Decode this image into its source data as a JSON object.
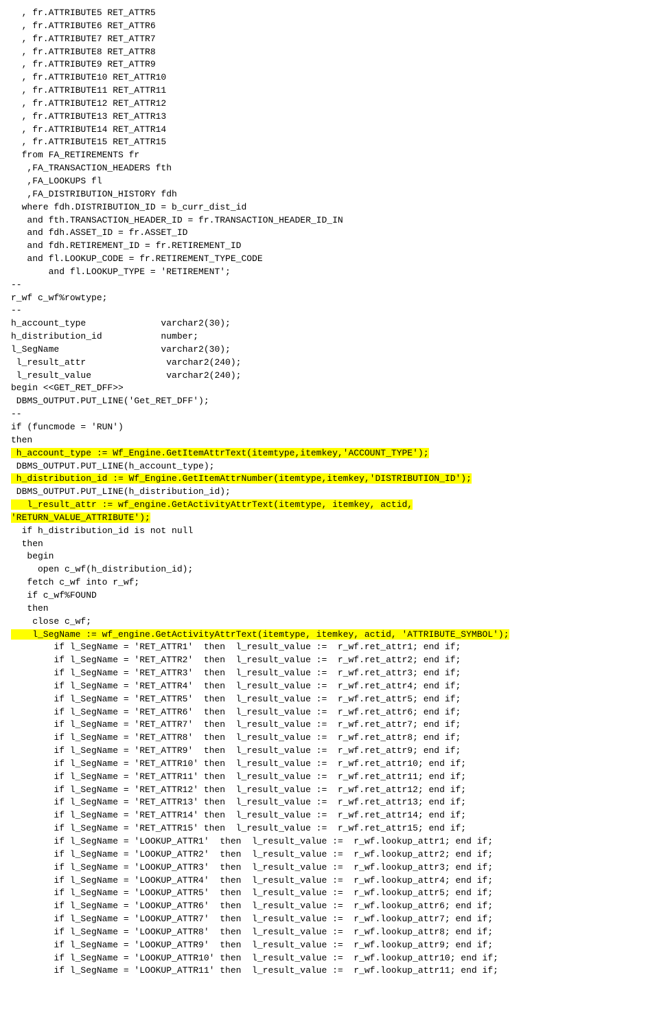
{
  "code": {
    "lines": [
      {
        "text": "  , fr.ATTRIBUTE5 RET_ATTR5",
        "highlight": false
      },
      {
        "text": "  , fr.ATTRIBUTE6 RET_ATTR6",
        "highlight": false
      },
      {
        "text": "  , fr.ATTRIBUTE7 RET_ATTR7",
        "highlight": false
      },
      {
        "text": "  , fr.ATTRIBUTE8 RET_ATTR8",
        "highlight": false
      },
      {
        "text": "  , fr.ATTRIBUTE9 RET_ATTR9",
        "highlight": false
      },
      {
        "text": "  , fr.ATTRIBUTE10 RET_ATTR10",
        "highlight": false
      },
      {
        "text": "  , fr.ATTRIBUTE11 RET_ATTR11",
        "highlight": false
      },
      {
        "text": "  , fr.ATTRIBUTE12 RET_ATTR12",
        "highlight": false
      },
      {
        "text": "  , fr.ATTRIBUTE13 RET_ATTR13",
        "highlight": false
      },
      {
        "text": "  , fr.ATTRIBUTE14 RET_ATTR14",
        "highlight": false
      },
      {
        "text": "  , fr.ATTRIBUTE15 RET_ATTR15",
        "highlight": false
      },
      {
        "text": "  from FA_RETIREMENTS fr",
        "highlight": false
      },
      {
        "text": "   ,FA_TRANSACTION_HEADERS fth",
        "highlight": false
      },
      {
        "text": "   ,FA_LOOKUPS fl",
        "highlight": false
      },
      {
        "text": "   ,FA_DISTRIBUTION_HISTORY fdh",
        "highlight": false
      },
      {
        "text": "  where fdh.DISTRIBUTION_ID = b_curr_dist_id",
        "highlight": false
      },
      {
        "text": "   and fth.TRANSACTION_HEADER_ID = fr.TRANSACTION_HEADER_ID_IN",
        "highlight": false
      },
      {
        "text": "   and fdh.ASSET_ID = fr.ASSET_ID",
        "highlight": false
      },
      {
        "text": "   and fdh.RETIREMENT_ID = fr.RETIREMENT_ID",
        "highlight": false
      },
      {
        "text": "   and fl.LOOKUP_CODE = fr.RETIREMENT_TYPE_CODE",
        "highlight": false
      },
      {
        "text": "       and fl.LOOKUP_TYPE = 'RETIREMENT';",
        "highlight": false
      },
      {
        "text": "--",
        "highlight": false
      },
      {
        "text": "r_wf c_wf%rowtype;",
        "highlight": false
      },
      {
        "text": "--",
        "highlight": false
      },
      {
        "text": "h_account_type              varchar2(30);",
        "highlight": false
      },
      {
        "text": "h_distribution_id           number;",
        "highlight": false
      },
      {
        "text": "l_SegName                   varchar2(30);",
        "highlight": false
      },
      {
        "text": " l_result_attr               varchar2(240);",
        "highlight": false
      },
      {
        "text": " l_result_value              varchar2(240);",
        "highlight": false
      },
      {
        "text": "",
        "highlight": false
      },
      {
        "text": "begin <<GET_RET_DFF>>",
        "highlight": false
      },
      {
        "text": " DBMS_OUTPUT.PUT_LINE('Get_RET_DFF');",
        "highlight": false
      },
      {
        "text": "--",
        "highlight": false
      },
      {
        "text": "if (funcmode = 'RUN')",
        "highlight": false
      },
      {
        "text": "then",
        "highlight": false
      },
      {
        "text": " h_account_type := Wf_Engine.GetItemAttrText(itemtype,itemkey,'ACCOUNT_TYPE');",
        "highlight": true
      },
      {
        "text": " DBMS_OUTPUT.PUT_LINE(h_account_type);",
        "highlight": false
      },
      {
        "text": " h_distribution_id := Wf_Engine.GetItemAttrNumber(itemtype,itemkey,'DISTRIBUTION_ID');",
        "highlight": true
      },
      {
        "text": " DBMS_OUTPUT.PUT_LINE(h_distribution_id);",
        "highlight": false
      },
      {
        "text": "   l_result_attr := wf_engine.GetActivityAttrText(itemtype, itemkey, actid,",
        "highlight": true
      },
      {
        "text": "'RETURN_VALUE_ATTRIBUTE');",
        "highlight": true
      },
      {
        "text": "  if h_distribution_id is not null",
        "highlight": false
      },
      {
        "text": "  then",
        "highlight": false
      },
      {
        "text": "   begin",
        "highlight": false
      },
      {
        "text": "     open c_wf(h_distribution_id);",
        "highlight": false
      },
      {
        "text": "   fetch c_wf into r_wf;",
        "highlight": false
      },
      {
        "text": "   if c_wf%FOUND",
        "highlight": false
      },
      {
        "text": "   then",
        "highlight": false
      },
      {
        "text": "    close c_wf;",
        "highlight": false
      },
      {
        "text": "    l_SegName := wf_engine.GetActivityAttrText(itemtype, itemkey, actid, 'ATTRIBUTE_SYMBOL');",
        "highlight": true
      },
      {
        "text": "        if l_SegName = 'RET_ATTR1'  then  l_result_value :=  r_wf.ret_attr1; end if;",
        "highlight": false
      },
      {
        "text": "        if l_SegName = 'RET_ATTR2'  then  l_result_value :=  r_wf.ret_attr2; end if;",
        "highlight": false
      },
      {
        "text": "        if l_SegName = 'RET_ATTR3'  then  l_result_value :=  r_wf.ret_attr3; end if;",
        "highlight": false
      },
      {
        "text": "        if l_SegName = 'RET_ATTR4'  then  l_result_value :=  r_wf.ret_attr4; end if;",
        "highlight": false
      },
      {
        "text": "        if l_SegName = 'RET_ATTR5'  then  l_result_value :=  r_wf.ret_attr5; end if;",
        "highlight": false
      },
      {
        "text": "        if l_SegName = 'RET_ATTR6'  then  l_result_value :=  r_wf.ret_attr6; end if;",
        "highlight": false
      },
      {
        "text": "        if l_SegName = 'RET_ATTR7'  then  l_result_value :=  r_wf.ret_attr7; end if;",
        "highlight": false
      },
      {
        "text": "        if l_SegName = 'RET_ATTR8'  then  l_result_value :=  r_wf.ret_attr8; end if;",
        "highlight": false
      },
      {
        "text": "        if l_SegName = 'RET_ATTR9'  then  l_result_value :=  r_wf.ret_attr9; end if;",
        "highlight": false
      },
      {
        "text": "        if l_SegName = 'RET_ATTR10' then  l_result_value :=  r_wf.ret_attr10; end if;",
        "highlight": false
      },
      {
        "text": "        if l_SegName = 'RET_ATTR11' then  l_result_value :=  r_wf.ret_attr11; end if;",
        "highlight": false
      },
      {
        "text": "        if l_SegName = 'RET_ATTR12' then  l_result_value :=  r_wf.ret_attr12; end if;",
        "highlight": false
      },
      {
        "text": "        if l_SegName = 'RET_ATTR13' then  l_result_value :=  r_wf.ret_attr13; end if;",
        "highlight": false
      },
      {
        "text": "        if l_SegName = 'RET_ATTR14' then  l_result_value :=  r_wf.ret_attr14; end if;",
        "highlight": false
      },
      {
        "text": "        if l_SegName = 'RET_ATTR15' then  l_result_value :=  r_wf.ret_attr15; end if;",
        "highlight": false
      },
      {
        "text": "",
        "highlight": false
      },
      {
        "text": "        if l_SegName = 'LOOKUP_ATTR1'  then  l_result_value :=  r_wf.lookup_attr1; end if;",
        "highlight": false
      },
      {
        "text": "        if l_SegName = 'LOOKUP_ATTR2'  then  l_result_value :=  r_wf.lookup_attr2; end if;",
        "highlight": false
      },
      {
        "text": "        if l_SegName = 'LOOKUP_ATTR3'  then  l_result_value :=  r_wf.lookup_attr3; end if;",
        "highlight": false
      },
      {
        "text": "        if l_SegName = 'LOOKUP_ATTR4'  then  l_result_value :=  r_wf.lookup_attr4; end if;",
        "highlight": false
      },
      {
        "text": "        if l_SegName = 'LOOKUP_ATTR5'  then  l_result_value :=  r_wf.lookup_attr5; end if;",
        "highlight": false
      },
      {
        "text": "        if l_SegName = 'LOOKUP_ATTR6'  then  l_result_value :=  r_wf.lookup_attr6; end if;",
        "highlight": false
      },
      {
        "text": "        if l_SegName = 'LOOKUP_ATTR7'  then  l_result_value :=  r_wf.lookup_attr7; end if;",
        "highlight": false
      },
      {
        "text": "        if l_SegName = 'LOOKUP_ATTR8'  then  l_result_value :=  r_wf.lookup_attr8; end if;",
        "highlight": false
      },
      {
        "text": "        if l_SegName = 'LOOKUP_ATTR9'  then  l_result_value :=  r_wf.lookup_attr9; end if;",
        "highlight": false
      },
      {
        "text": "        if l_SegName = 'LOOKUP_ATTR10' then  l_result_value :=  r_wf.lookup_attr10; end if;",
        "highlight": false
      },
      {
        "text": "        if l_SegName = 'LOOKUP_ATTR11' then  l_result_value :=  r_wf.lookup_attr11; end if;",
        "highlight": false
      }
    ]
  }
}
